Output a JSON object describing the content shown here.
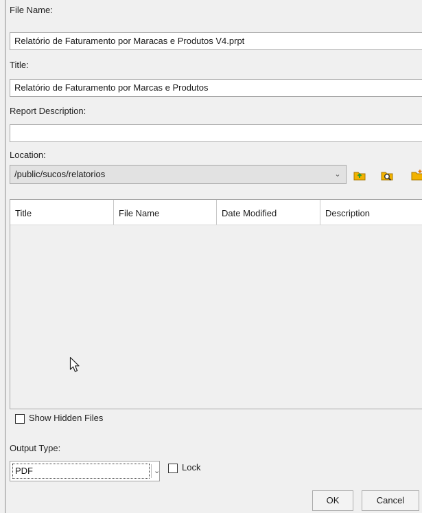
{
  "file_name": {
    "label": "File Name:",
    "value": "Relatório de Faturamento por Maracas e Produtos V4.prpt"
  },
  "title": {
    "label": "Title:",
    "value": "Relatório de Faturamento por Marcas e Produtos"
  },
  "report_description": {
    "label": "Report Description:",
    "value": ""
  },
  "location": {
    "label": "Location:",
    "value": "/public/sucos/relatorios"
  },
  "toolbar_icons": [
    "folder-up-icon",
    "browse-folder-icon",
    "new-folder-icon"
  ],
  "table": {
    "columns": [
      "Title",
      "File Name",
      "Date Modified",
      "Description"
    ],
    "rows": []
  },
  "show_hidden_files": {
    "label": "Show Hidden Files",
    "checked": false
  },
  "output_type": {
    "label": "Output Type:",
    "value": "PDF"
  },
  "lock": {
    "label": "Lock",
    "checked": false
  },
  "buttons": {
    "ok": "OK",
    "cancel": "Cancel"
  },
  "colors": {
    "folder_yellow": "#f2b200",
    "folder_green": "#2e9e2e",
    "background": "#f0f0f0"
  }
}
